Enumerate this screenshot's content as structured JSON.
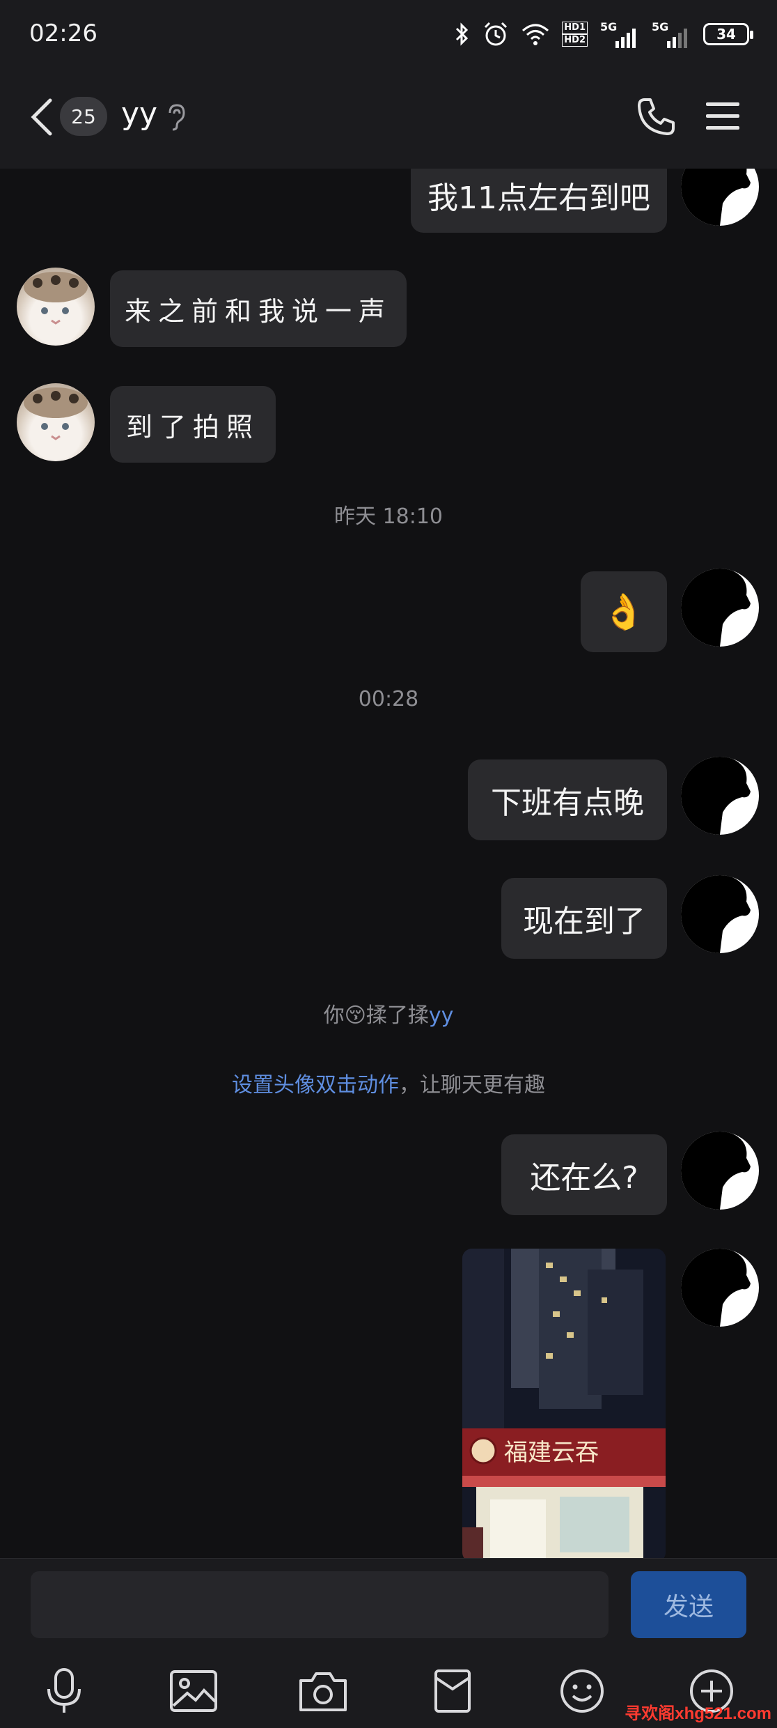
{
  "status_bar": {
    "time": "02:26",
    "hd_top": "HD1",
    "hd_bottom": "HD2",
    "net1": "5G",
    "net2": "5G",
    "battery": "34"
  },
  "header": {
    "unread_count": "25",
    "contact_name": "yy"
  },
  "messages": [
    {
      "from": "me",
      "text": "我11点左右到吧"
    },
    {
      "from": "them",
      "text": "来之前和我说一声"
    },
    {
      "from": "them",
      "text": "到了拍照"
    },
    {
      "timestamp": "昨天 18:10"
    },
    {
      "from": "me",
      "text": "👌"
    },
    {
      "timestamp": "00:28"
    },
    {
      "from": "me",
      "text": "下班有点晚"
    },
    {
      "from": "me",
      "text": "现在到了"
    },
    {
      "system": {
        "prefix": "你",
        "emoji": "😚",
        "action": "揉了揉",
        "target": "yy"
      }
    },
    {
      "system2": {
        "link": "设置头像双击动作",
        "rest": "，让聊天更有趣"
      }
    },
    {
      "from": "me",
      "text": "还在么?"
    },
    {
      "from": "me",
      "photo": {
        "sign_text": "福建云吞"
      }
    }
  ],
  "input": {
    "placeholder": "",
    "send_label": "发送"
  },
  "toolbar": [
    "voice",
    "image",
    "camera",
    "red-packet",
    "emoji",
    "more"
  ],
  "watermark": "寻欢阁xhg521.com",
  "colors": {
    "send_button": "#1d4f99",
    "link": "#5f8ee0",
    "bubble": "#2a2a2d"
  }
}
